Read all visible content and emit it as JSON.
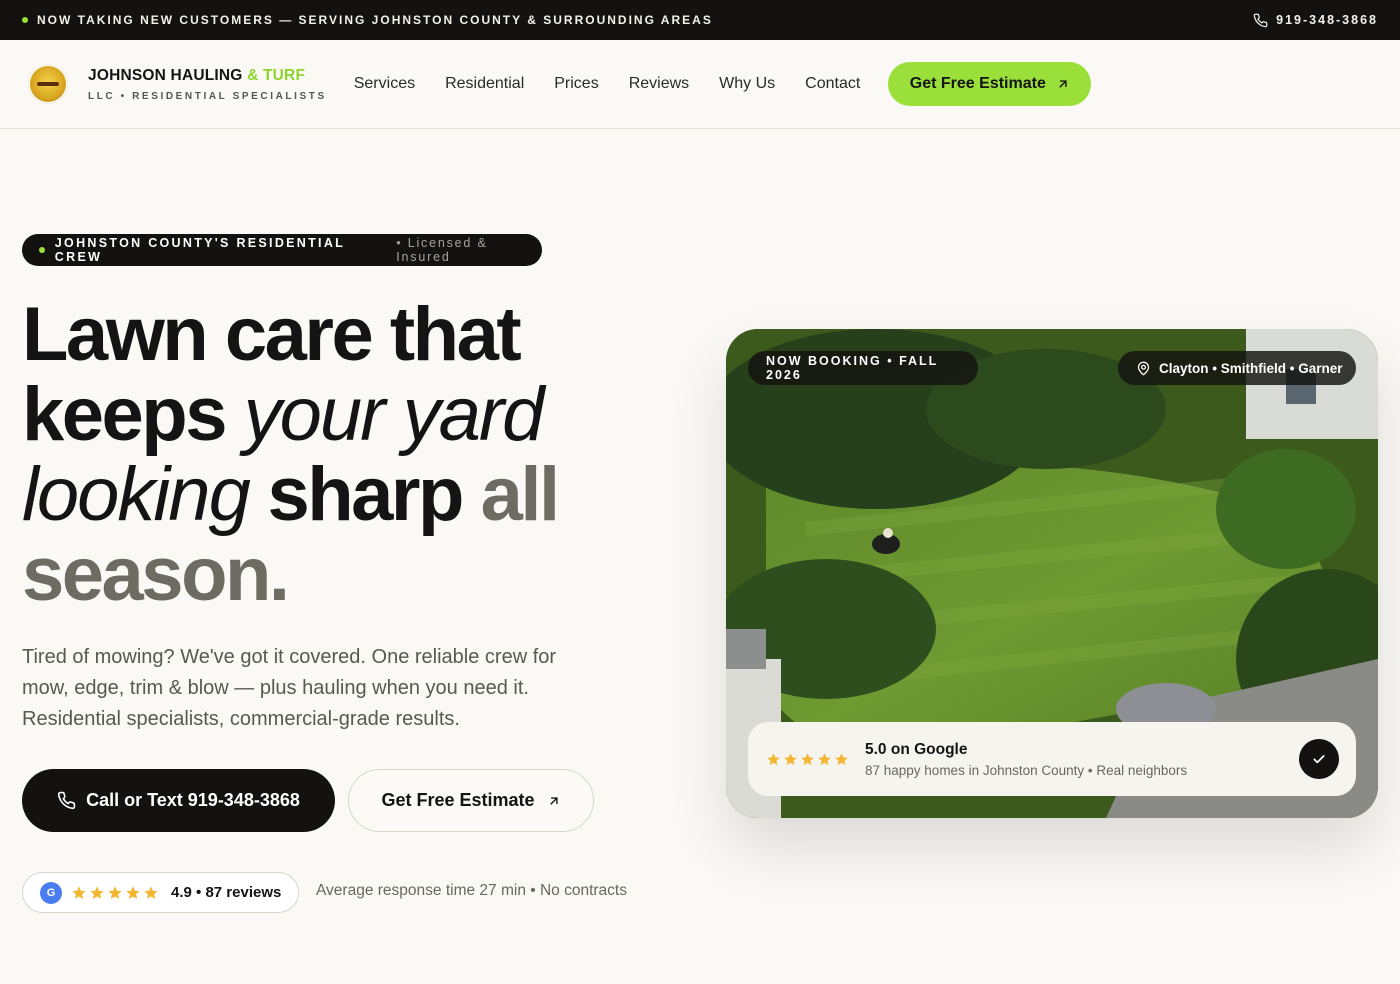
{
  "topbar": {
    "announcement": "NOW TAKING NEW CUSTOMERS — SERVING JOHNSTON COUNTY & SURROUNDING AREAS",
    "phone": "919-348-3868"
  },
  "brand": {
    "name_main": "JOHNSON HAULING",
    "name_accent": "& TURF",
    "subtitle": "LLC • RESIDENTIAL SPECIALISTS"
  },
  "nav": {
    "items": [
      {
        "label": "Services"
      },
      {
        "label": "Residential"
      },
      {
        "label": "Prices"
      },
      {
        "label": "Reviews"
      },
      {
        "label": "Why Us"
      },
      {
        "label": "Contact"
      }
    ],
    "cta": "Get Free Estimate"
  },
  "hero": {
    "pill_main": "JOHNSTON COUNTY'S RESIDENTIAL CREW",
    "pill_sub": "• Licensed & Insured",
    "headline": {
      "w1": "Lawn care that",
      "w2": "keeps",
      "w3": "your yard",
      "w4": "looking",
      "w5": "sharp",
      "w6": "all",
      "w7": "season."
    },
    "lead": "Tired of mowing? We've got it covered. One reliable crew for mow, edge, trim & blow — plus hauling when you need it. Residential specialists, commercial-grade results.",
    "call_button": "Call or Text 919-348-3868",
    "estimate_button": "Get Free Estimate",
    "google_letter": "G",
    "rating": 4.9,
    "rating_text": "4.9 • 87 reviews",
    "response_text": "Average response time 27 min • No contracts"
  },
  "photo": {
    "booking_chip": "NOW BOOKING  • FALL 2026",
    "location_chip": "Clayton • Smithfield • Garner",
    "review_title": "5.0 on Google",
    "review_sub": "87 happy homes in Johnston County • Real neighbors",
    "stars": 5
  },
  "colors": {
    "accent": "#9be03a",
    "dark": "#141210",
    "star": "#f2b630"
  }
}
